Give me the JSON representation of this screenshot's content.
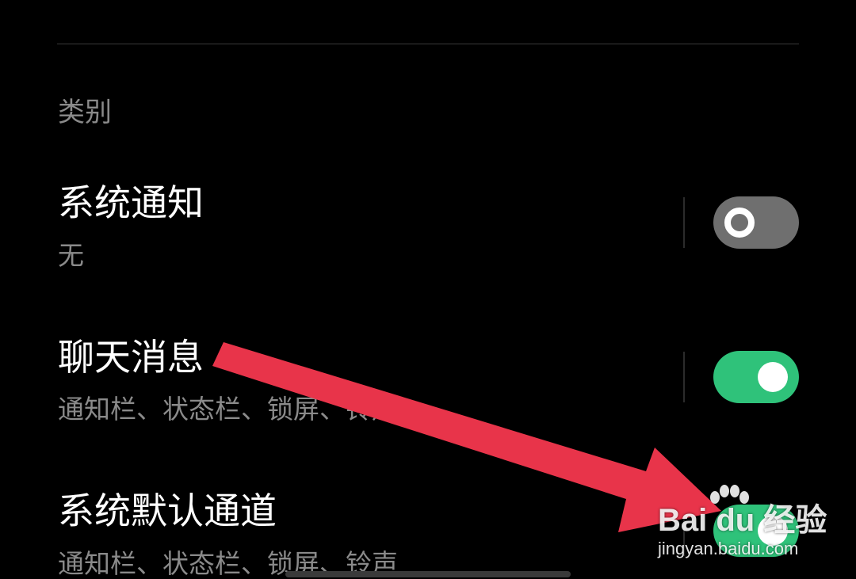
{
  "section": {
    "header": "类别"
  },
  "rows": [
    {
      "title": "系统通知",
      "subtitle": "无",
      "toggle_on": false
    },
    {
      "title": "聊天消息",
      "subtitle": "通知栏、状态栏、锁屏、铃声",
      "toggle_on": true
    },
    {
      "title": "系统默认通道",
      "subtitle": "通知栏、状态栏、锁屏、铃声",
      "toggle_on": true
    }
  ],
  "colors": {
    "toggle_on": "#2fc27a",
    "toggle_off": "#6f6f6f",
    "annotation_arrow": "#e8344a"
  },
  "watermark": {
    "brand": "Bai du 经验",
    "url": "jingyan.baidu.com"
  }
}
